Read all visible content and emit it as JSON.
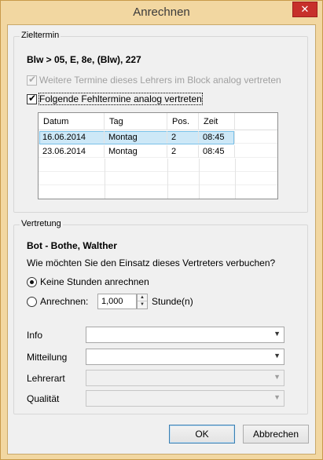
{
  "window": {
    "title": "Anrechnen",
    "close_glyph": "✕"
  },
  "zieltermin": {
    "group_label": "Zieltermin",
    "lesson": "Blw > 05, E, 8e, (Blw), 227",
    "checkbox_weitere": {
      "label": "Weitere Termine dieses Lehrers im Block analog vertreten",
      "checked": true,
      "enabled": false
    },
    "checkbox_folgende": {
      "label": "Folgende Fehltermine analog vertreten",
      "checked": true,
      "enabled": true
    },
    "table": {
      "columns": [
        "Datum",
        "Tag",
        "Pos.",
        "Zeit"
      ],
      "rows": [
        {
          "datum": "16.06.2014",
          "tag": "Montag",
          "pos": "2",
          "zeit": "08:45",
          "selected": true
        },
        {
          "datum": "23.06.2014",
          "tag": "Montag",
          "pos": "2",
          "zeit": "08:45",
          "selected": false
        }
      ]
    }
  },
  "vertretung": {
    "group_label": "Vertretung",
    "teacher": "Bot - Bothe, Walther",
    "question": "Wie möchten Sie den Einsatz dieses Vertreters verbuchen?",
    "radio_keine": {
      "label": "Keine Stunden anrechnen",
      "selected": true
    },
    "radio_anrechnen": {
      "label": "Anrechnen:",
      "selected": false
    },
    "hours_value": "1,000",
    "hours_unit": "Stunde(n)",
    "fields": {
      "info": {
        "label": "Info",
        "value": "",
        "enabled": true
      },
      "mitteilung": {
        "label": "Mitteilung",
        "value": "",
        "enabled": true
      },
      "lehrerart": {
        "label": "Lehrerart",
        "value": "",
        "enabled": false
      },
      "qualitaet": {
        "label": "Qualität",
        "value": "",
        "enabled": false
      }
    }
  },
  "buttons": {
    "ok": "OK",
    "abbrechen": "Abbrechen"
  },
  "icons": {
    "check": "✔",
    "dropdown": "▼",
    "spin_up": "▲",
    "spin_down": "▼"
  }
}
